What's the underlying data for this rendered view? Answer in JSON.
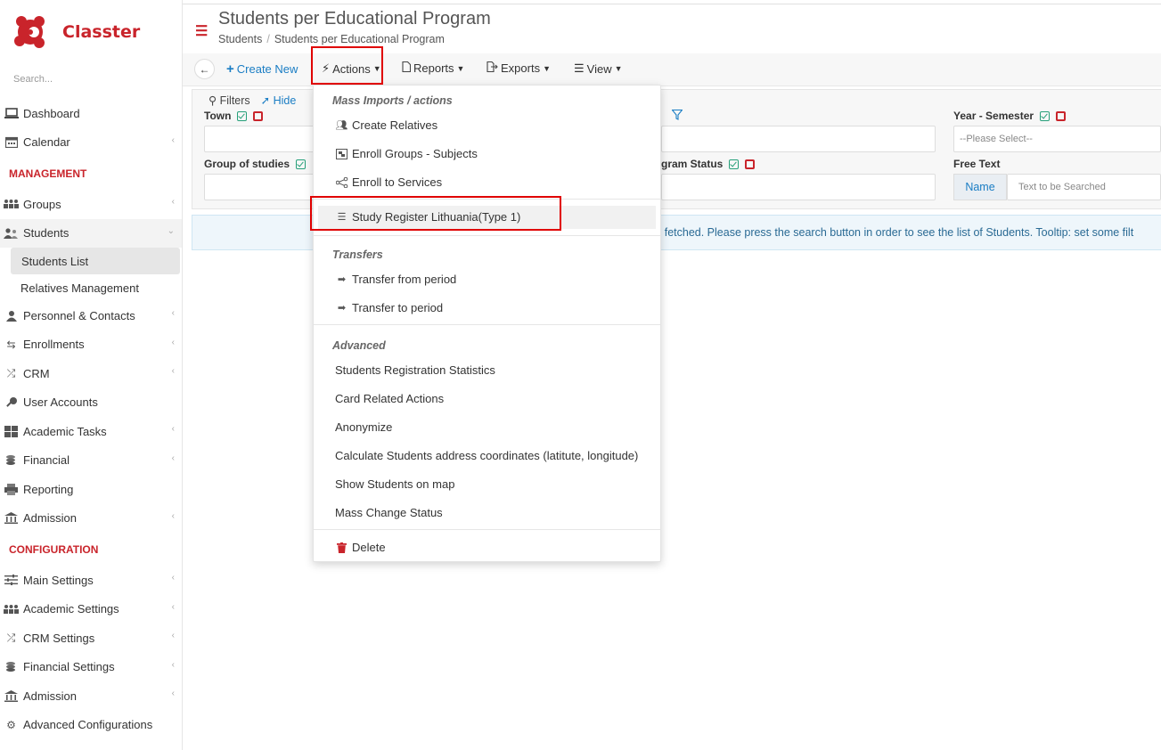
{
  "app": {
    "brand": "Classter",
    "brand_color": "#c9242b"
  },
  "sidebar": {
    "search_placeholder": "Search...",
    "items_top": [
      {
        "label": "Dashboard",
        "icon": "laptop-icon"
      },
      {
        "label": "Calendar",
        "icon": "calendar-icon"
      }
    ],
    "section_management": "MANAGEMENT",
    "groups": "Groups",
    "students": "Students",
    "students_list": "Students List",
    "relatives_management": "Relatives Management",
    "items_mgmt": [
      {
        "label": "Personnel & Contacts"
      },
      {
        "label": "Enrollments"
      },
      {
        "label": "CRM"
      },
      {
        "label": "User Accounts"
      },
      {
        "label": "Academic Tasks"
      },
      {
        "label": "Financial"
      },
      {
        "label": "Reporting"
      },
      {
        "label": "Admission"
      }
    ],
    "section_configuration": "CONFIGURATION",
    "items_config": [
      {
        "label": "Main Settings"
      },
      {
        "label": "Academic Settings"
      },
      {
        "label": "CRM Settings"
      },
      {
        "label": "Financial Settings"
      },
      {
        "label": "Admission"
      },
      {
        "label": "Advanced Configurations"
      }
    ]
  },
  "header": {
    "title": "Students per Educational Program",
    "breadcrumb": [
      "Students",
      "Students per Educational Program"
    ]
  },
  "toolbar": {
    "create_new": "Create New",
    "actions": "Actions",
    "reports": "Reports",
    "exports": "Exports",
    "view": "View"
  },
  "filters": {
    "title": "Filters",
    "hide": "Hide",
    "town": "Town",
    "group_of_studies": "Group of studies",
    "program_status": "gram Status",
    "year_semester": "Year - Semester",
    "year_semester_placeholder": "--Please Select--",
    "free_text": "Free Text",
    "name_addon": "Name",
    "free_text_placeholder": "Text to be Searched"
  },
  "info_message": "s fetched. Please press the search button in order to see the list of Students. Tooltip: set some filt",
  "dropdown": {
    "header_mass": "Mass Imports / actions",
    "create_relatives": "Create Relatives",
    "enroll_groups_subjects": "Enroll Groups - Subjects",
    "enroll_to_services": "Enroll to Services",
    "study_register": "Study Register Lithuania(Type 1)",
    "header_transfers": "Transfers",
    "transfer_from_period": "Transfer from period",
    "transfer_to_period": "Transfer to period",
    "header_advanced": "Advanced",
    "students_registration_statistics": "Students Registration Statistics",
    "card_related_actions": "Card Related Actions",
    "anonymize": "Anonymize",
    "calculate_coordinates": "Calculate Students address coordinates (latitute, longitude)",
    "show_on_map": "Show Students on map",
    "mass_change_status": "Mass Change Status",
    "delete": "Delete"
  }
}
